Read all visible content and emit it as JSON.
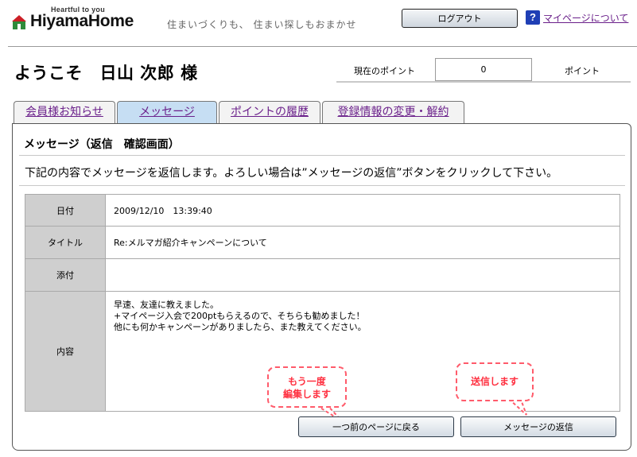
{
  "header": {
    "logo_tagline": "Heartful to you",
    "logo_text": "HiyamaHome",
    "site_tagline": "住まいづくりも、 住まい探しもおまかせ",
    "logout_label": "ログアウト",
    "help_link": "マイページについて"
  },
  "welcome": {
    "text": "ようこそ　日山 次郎 様"
  },
  "points": {
    "label": "現在のポイント",
    "value": "0",
    "unit": "ポイント"
  },
  "tabs": [
    {
      "label": "会員様お知らせ",
      "active": false
    },
    {
      "label": "メッセージ",
      "active": true
    },
    {
      "label": "ポイントの履歴",
      "active": false
    },
    {
      "label": "登録情報の変更・解約",
      "active": false
    }
  ],
  "panel": {
    "title": "メッセージ（返信　確認画面）",
    "instruction": "下記の内容でメッセージを返信します。よろしい場合は”メッセージの返信”ボタンをクリックして下さい。"
  },
  "message": {
    "date_label": "日付",
    "date_value": "2009/12/10　13:39:40",
    "title_label": "タイトル",
    "title_value": "Re:メルマガ紹介キャンペーンについて",
    "attach_label": "添付",
    "attach_value": "",
    "content_label": "内容",
    "content_value": "早速、友達に教えました。\n+マイページ入会で200ptもらえるので、そちらも勧めました！\n他にも何かキャンペーンがありましたら、また教えてください。"
  },
  "buttons": {
    "back_label": "一つ前のページに戻る",
    "reply_label": "メッセージの返信"
  },
  "callouts": {
    "edit_line1": "もう一度",
    "edit_line2": "編集します",
    "send": "送信します"
  },
  "colors": {
    "brand_red": "#cc1f26",
    "brand_green": "#2e8b3a",
    "link_purple": "#6a1f8a",
    "active_tab": "#c6def3",
    "callout": "#ff3040",
    "help_blue": "#1f3fb5"
  },
  "icons": {
    "logo": "house-logo-icon",
    "help": "question-mark-icon"
  }
}
